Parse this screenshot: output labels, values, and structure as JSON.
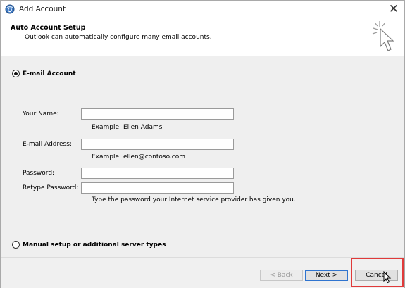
{
  "window": {
    "title": "Add Account",
    "close_glyph": "✕"
  },
  "header": {
    "title": "Auto Account Setup",
    "subtitle": "Outlook can automatically configure many email accounts."
  },
  "email_account": {
    "option_label": "E-mail Account",
    "selected": true,
    "fields": {
      "name_label": "Your Name:",
      "name_value": "",
      "name_hint": "Example: Ellen Adams",
      "email_label": "E-mail Address:",
      "email_value": "",
      "email_hint": "Example: ellen@contoso.com",
      "password_label": "Password:",
      "password_value": "",
      "retype_label": "Retype Password:",
      "retype_value": "",
      "password_hint": "Type the password your Internet service provider has given you."
    }
  },
  "manual_setup": {
    "option_label": "Manual setup or additional server types",
    "selected": false
  },
  "footer": {
    "back_label": "< Back",
    "next_label": "Next >",
    "cancel_label": "Cancel"
  },
  "colors": {
    "highlight": "#e03a3a",
    "default_button_border": "#2f74cf",
    "body_bg": "#efefef"
  },
  "icons": [
    "outlook-app-icon",
    "close-icon",
    "wizard-sparkle-icon",
    "mouse-cursor-icon"
  ]
}
